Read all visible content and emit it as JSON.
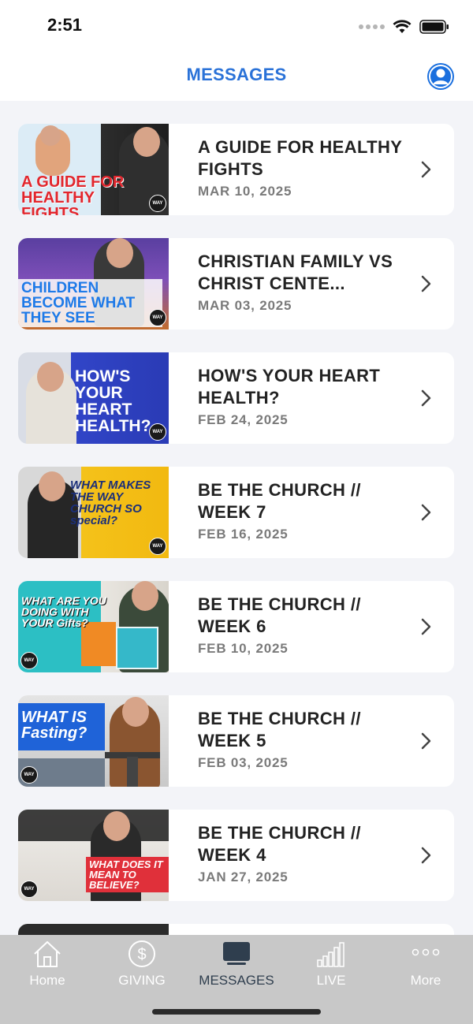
{
  "status_bar": {
    "time": "2:51"
  },
  "header": {
    "title": "MESSAGES"
  },
  "messages": [
    {
      "title": "A GUIDE FOR HEALTHY FIGHTS",
      "date": "MAR 10, 2025",
      "thumb_text": "A GUIDE FOR HEALTHY FIGHTS"
    },
    {
      "title": "CHRISTIAN FAMILY VS CHRIST CENTE...",
      "date": "MAR 03, 2025",
      "thumb_text": "CHILDREN BECOME WHAT THEY SEE"
    },
    {
      "title": "HOW'S YOUR HEART HEALTH?",
      "date": "FEB 24, 2025",
      "thumb_text": "HOW'S YOUR HEART HEALTH?"
    },
    {
      "title": "BE THE CHURCH // WEEK 7",
      "date": "FEB 16, 2025",
      "thumb_text": "WHAT MAKES THE WAY CHURCH SO special?"
    },
    {
      "title": "BE THE CHURCH // WEEK 6",
      "date": "FEB 10, 2025",
      "thumb_text": "WHAT ARE YOU DOING WITH YOUR Gifts?"
    },
    {
      "title": "BE THE CHURCH // WEEK 5",
      "date": "FEB 03, 2025",
      "thumb_text": "WHAT IS Fasting?"
    },
    {
      "title": "BE THE CHURCH // WEEK 4",
      "date": "JAN 27, 2025",
      "thumb_text": "WHAT DOES IT MEAN TO BELIEVE?"
    }
  ],
  "tab_bar": {
    "tabs": [
      {
        "label": "Home",
        "icon": "home-icon"
      },
      {
        "label": "GIVING",
        "icon": "dollar-icon"
      },
      {
        "label": "MESSAGES",
        "icon": "monitor-icon",
        "active": true
      },
      {
        "label": "LIVE",
        "icon": "signal-bars-icon"
      },
      {
        "label": "More",
        "icon": "more-dots-icon"
      }
    ]
  },
  "colors": {
    "accent": "#2a72d8",
    "tab_bar_bg": "#c8c8c8",
    "active_tab": "#2f3e4e"
  }
}
